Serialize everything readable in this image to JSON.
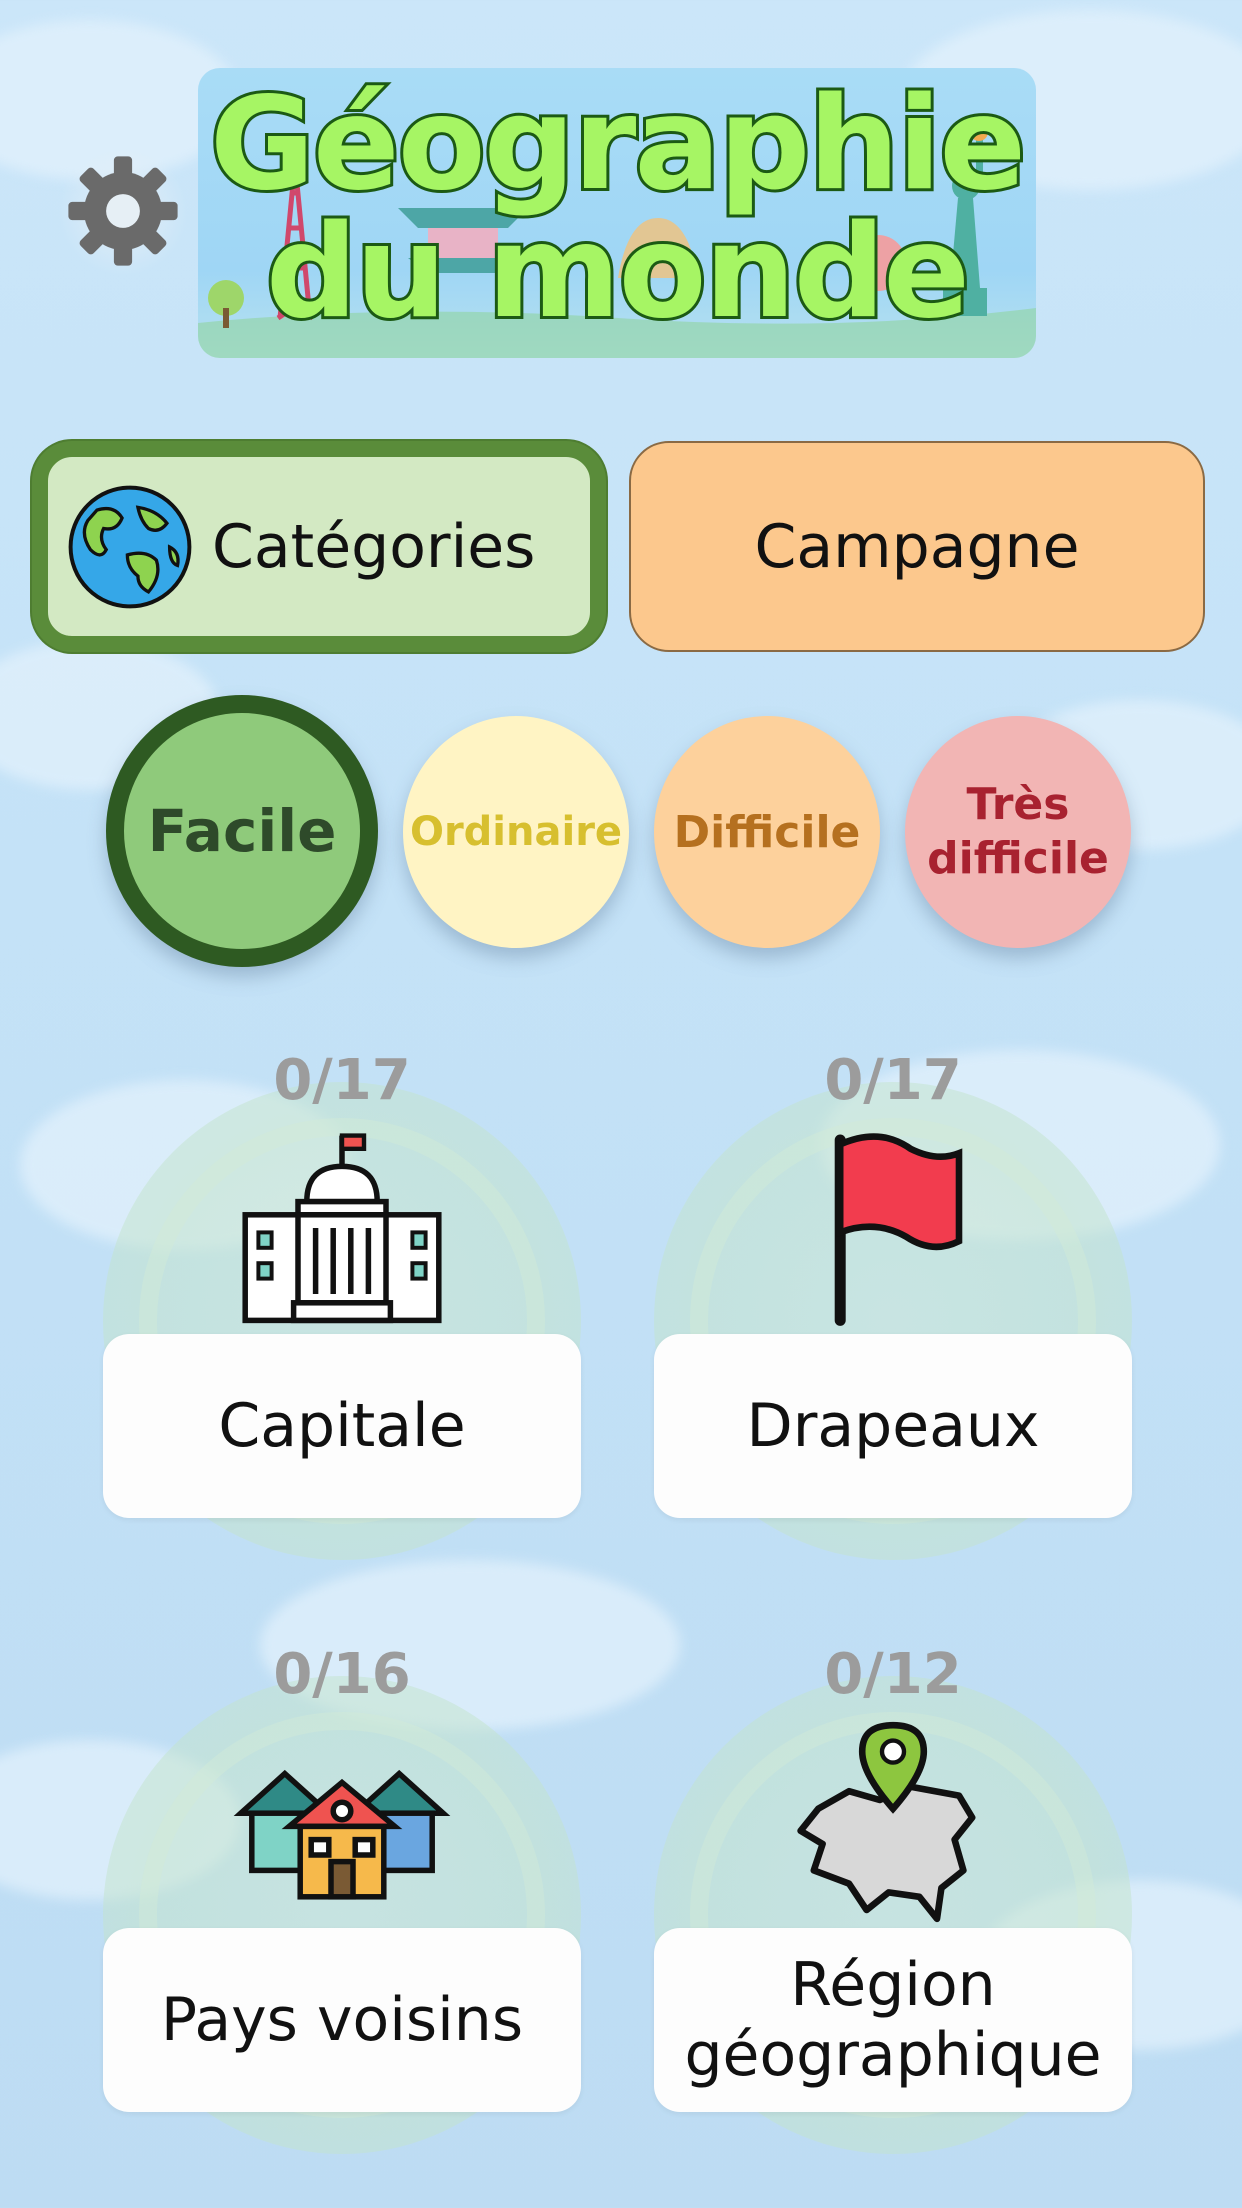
{
  "header": {
    "title_line1": "Géographie",
    "title_line2": "du monde"
  },
  "tabs": {
    "categories": "Catégories",
    "campaign": "Campagne"
  },
  "difficulties": {
    "easy": "Facile",
    "normal": "Ordinaire",
    "hard": "Difficile",
    "very_hard_1": "Très",
    "very_hard_2": "difficile",
    "selected": "Facile"
  },
  "categories": {
    "capital": {
      "label": "Capitale",
      "progress": "0/17",
      "icon": "capitol-building-icon"
    },
    "flags": {
      "label": "Drapeaux",
      "progress": "0/17",
      "icon": "red-flag-icon"
    },
    "neighbors": {
      "label": "Pays voisins",
      "progress": "0/16",
      "icon": "houses-icon"
    },
    "region_1": "Région",
    "region_2": "géographique",
    "region_progress": "0/12",
    "region_icon": "map-pin-icon"
  },
  "colors": {
    "tab_selected_bg": "#d3e9c3",
    "tab_selected_border": "#5a8c3a",
    "campaign_bg": "#fcc88d",
    "easy": "#8fca7b",
    "normal": "#fff4c4",
    "hard": "#fdd19c",
    "very_hard": "#f2b5b4"
  }
}
